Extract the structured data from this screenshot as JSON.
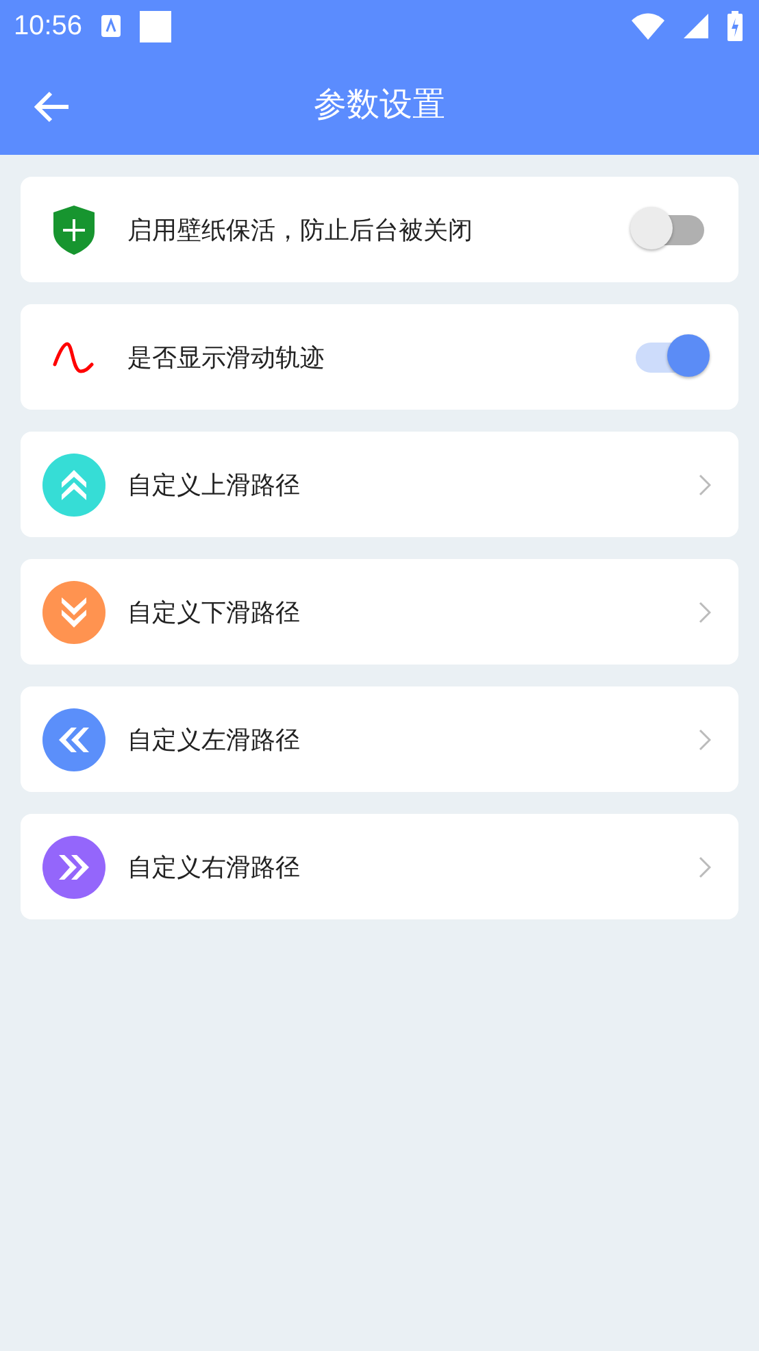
{
  "status_bar": {
    "time": "10:56"
  },
  "app_bar": {
    "title": "参数设置"
  },
  "items": [
    {
      "kind": "toggle",
      "label": "启用壁纸保活，防止后台被关闭",
      "on": false
    },
    {
      "kind": "toggle",
      "label": "是否显示滑动轨迹",
      "on": true
    },
    {
      "kind": "link",
      "color": "#36ddd6",
      "label": "自定义上滑路径"
    },
    {
      "kind": "link",
      "color": "#ff9350",
      "label": "自定义下滑路径"
    },
    {
      "kind": "link",
      "color": "#5b8ffa",
      "label": "自定义左滑路径"
    },
    {
      "kind": "link",
      "color": "#9466fb",
      "label": "自定义右滑路径"
    }
  ]
}
